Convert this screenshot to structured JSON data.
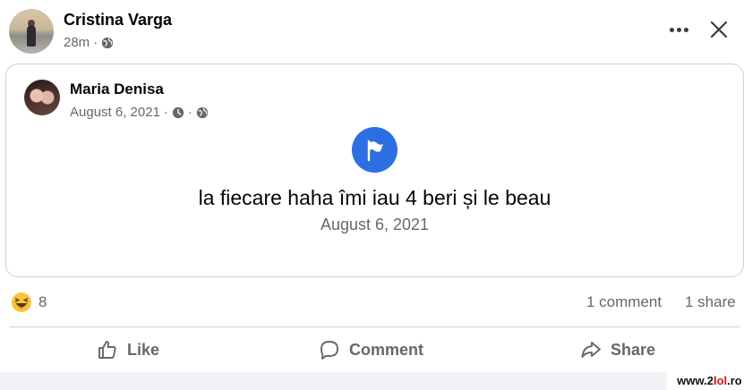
{
  "post": {
    "author": "Cristina Varga",
    "time": "28m",
    "separator": "·"
  },
  "shared": {
    "author": "Maria Denisa",
    "date": "August 6, 2021",
    "separator": "·",
    "event_text": "la fiecare haha îmi iau 4 beri și le beau",
    "event_date": "August 6, 2021"
  },
  "stats": {
    "reaction_count": "8",
    "comments": "1 comment",
    "shares": "1 share"
  },
  "actions": {
    "like": "Like",
    "comment": "Comment",
    "share": "Share"
  },
  "watermark": {
    "prefix": "www.2",
    "accent": "lol",
    "suffix": ".ro"
  },
  "icons": {
    "privacy": "globe-icon",
    "clock": "clock-icon",
    "event": "flag-icon",
    "reaction": "haha-emoji-icon",
    "more": "more-icon",
    "close": "close-icon"
  },
  "colors": {
    "accent": "#2d6fe3",
    "secondary_text": "#65676b",
    "border": "#ced0d4"
  }
}
